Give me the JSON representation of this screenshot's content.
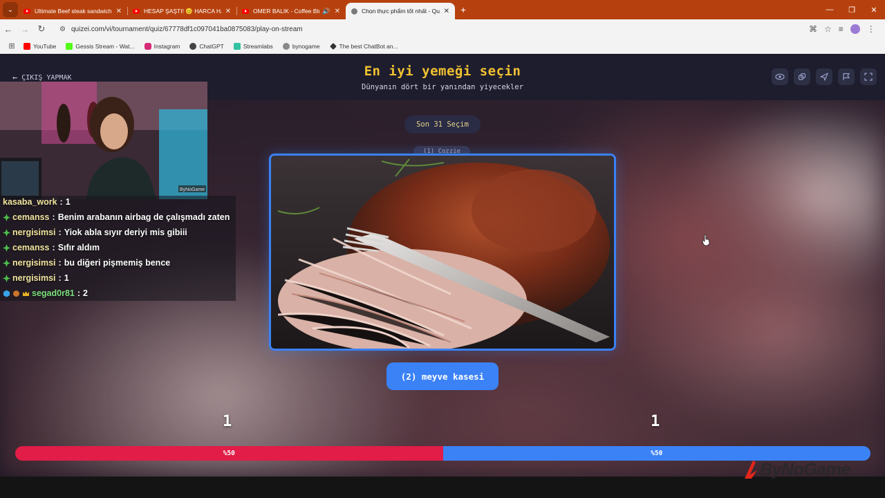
{
  "browser": {
    "tabs": [
      {
        "title": "Ultimate Beef steak sandwichi",
        "icon": "youtube-icon",
        "active": false
      },
      {
        "title": "HESAP ŞAŞTI! 😊 HARCA HARI",
        "icon": "youtube-icon",
        "active": false
      },
      {
        "title": "OMER BALIK - Coffee Blues",
        "icon": "youtube-icon",
        "active": false,
        "audio": true
      },
      {
        "title": "Chọn thực phẩm tốt nhất - Qu",
        "icon": "globe-icon",
        "active": true
      }
    ],
    "url": "quizei.com/vi/tournament/quiz/67778df1c097041ba0875083/play-on-stream",
    "bookmarks": [
      {
        "label": "YouTube",
        "color": "#ff0000"
      },
      {
        "label": "Gessis Stream - Wat...",
        "color": "#53fc18"
      },
      {
        "label": "Instagram",
        "color": "#d62976"
      },
      {
        "label": "ChatGPT",
        "color": "#444444"
      },
      {
        "label": "Streamlabs",
        "color": "#31c3a2"
      },
      {
        "label": "bynogame",
        "color": "#888888"
      },
      {
        "label": "The best ChatBot an...",
        "color": "#333333"
      }
    ]
  },
  "quiz": {
    "back_label": "ÇIKIŞ YAPMAK",
    "title": "En iyi yemeği seçin",
    "subtitle": "Dünyanın dört bir yanından yiyecekler",
    "round_label": "Son 31 Seçim",
    "ghost_label": "(1) Cozzie",
    "choice_label": "(2) meyve kasesi",
    "left_votes": "1",
    "right_votes": "1",
    "left_percent_label": "%50",
    "right_percent_label": "%50",
    "left_share": 0.5,
    "right_share": 0.5,
    "colors": {
      "accent": "#3b82f6",
      "title": "#f2c230",
      "left": "#e11d48",
      "right": "#3b82f6"
    }
  },
  "chat": {
    "messages": [
      {
        "user": "kasaba_work",
        "text": "1",
        "badge": "none"
      },
      {
        "user": "cemanss",
        "text": "Benim arabanın airbag de çalışmadı zaten",
        "badge": "green"
      },
      {
        "user": "nergisimsi",
        "text": "Yiok abla sıyır deriyi mis gibiii",
        "badge": "green"
      },
      {
        "user": "cemanss",
        "text": "Sıfır aldım",
        "badge": "green"
      },
      {
        "user": "nergisimsi",
        "text": "bu diğeri pişmemiş bence",
        "badge": "green"
      },
      {
        "user": "nergisimsi",
        "text": "1",
        "badge": "green"
      },
      {
        "user": "segad0r81",
        "text": "2",
        "badge": "multi"
      }
    ]
  },
  "overlay": {
    "watermark": "ByNoGame",
    "webcam_tag": "ByNoGame"
  }
}
